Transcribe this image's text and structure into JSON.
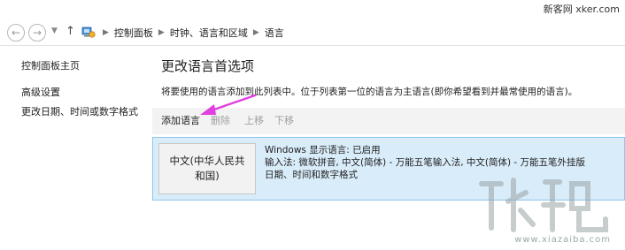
{
  "window": {
    "watermark_top": "新客网 xker.com"
  },
  "nav": {
    "breadcrumbs": [
      "控制面板",
      "时钟、语言和区域",
      "语言"
    ]
  },
  "sidebar": {
    "items": [
      {
        "label": "控制面板主页"
      },
      {
        "label": "高级设置"
      },
      {
        "label": "更改日期、时间或数字格式"
      }
    ]
  },
  "main": {
    "title": "更改语言首选项",
    "description": "将要使用的语言添加到此列表中。位于列表第一位的语言为主语言(即你希望看到并最常使用的语言)。",
    "toolbar": {
      "add": "添加语言",
      "remove": "删除",
      "up": "上移",
      "down": "下移"
    },
    "languages": [
      {
        "name": "中文(中华人民共和国)",
        "details": [
          "Windows 显示语言: 已启用",
          "输入法: 微软拼音, 中文(简体) - 万能五笔输入法, 中文(简体) - 万能五笔外挂版",
          "日期、时间和数字格式"
        ]
      }
    ]
  },
  "watermark_url": "www.xiazaiba.com",
  "colors": {
    "selected_row_bg": "#d9ecf9",
    "selected_row_border": "#8fc5eb",
    "annotation_arrow": "#e040e0"
  }
}
